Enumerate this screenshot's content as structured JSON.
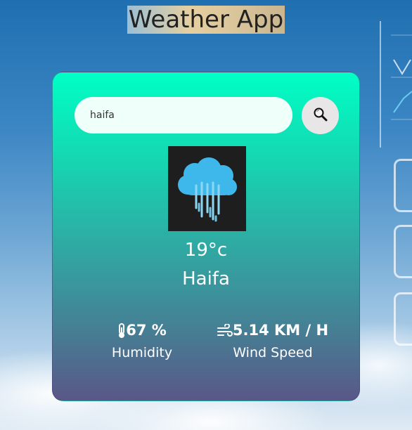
{
  "app": {
    "title": "Weather App"
  },
  "search": {
    "value": "haifa",
    "placeholder": ""
  },
  "weather": {
    "icon": "rain-cloud-icon",
    "temperature": "19°c",
    "city": "Haifa"
  },
  "stats": {
    "humidity": {
      "value": "67 %",
      "label": "Humidity",
      "icon": "thermometer-icon"
    },
    "wind": {
      "value": "5.14 KM / H",
      "label": "Wind Speed",
      "icon": "wind-icon"
    }
  },
  "colors": {
    "card_top": "#00ffc6",
    "card_bottom": "#5a5788",
    "search_bg": "#effff9",
    "button_bg": "#e8e6e6"
  }
}
